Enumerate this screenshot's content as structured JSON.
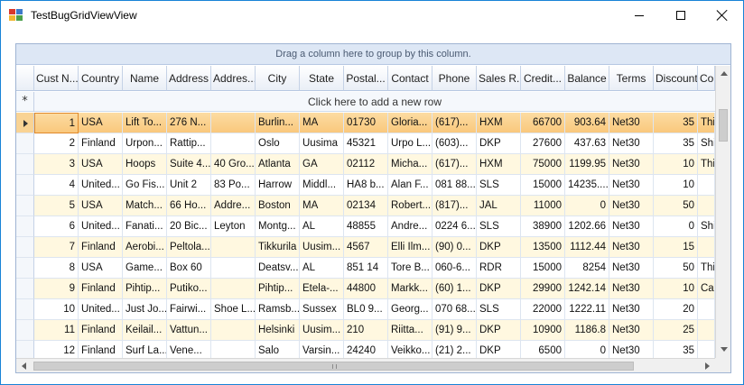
{
  "window": {
    "title": "TestBugGridViewView",
    "icon": "app-window-icon"
  },
  "grid": {
    "group_panel_text": "Drag a column here to group by this column.",
    "new_row_text": "Click here to add a new row",
    "new_row_symbol": "*",
    "columns": [
      "Cust N...",
      "Country",
      "Name",
      "Address",
      "Addres...",
      "City",
      "State",
      "Postal...",
      "Contact",
      "Phone",
      "Sales R...",
      "Credit...",
      "Balance",
      "Terms",
      "Discount",
      "Co"
    ],
    "rows": [
      [
        "1",
        "USA",
        "Lift To...",
        "276 N...",
        "",
        "Burlin...",
        "MA",
        "01730",
        "Gloria...",
        "(617)...",
        "HXM",
        "66700",
        "903.64",
        "Net30",
        "35",
        "Thi"
      ],
      [
        "2",
        "Finland",
        "Urpon...",
        "Rattip...",
        "",
        "Oslo",
        "Uusima",
        "45321",
        "Urpo L...",
        "(603)...",
        "DKP",
        "27600",
        "437.63",
        "Net30",
        "35",
        "Shi"
      ],
      [
        "3",
        "USA",
        "Hoops",
        "Suite 4...",
        "40 Gro...",
        "Atlanta",
        "GA",
        "02112",
        "Micha...",
        "(617)...",
        "HXM",
        "75000",
        "1199.95",
        "Net30",
        "10",
        "Thi"
      ],
      [
        "4",
        "United...",
        "Go Fis...",
        "Unit 2",
        "83 Po...",
        "Harrow",
        "Middl...",
        "HA8 b...",
        "Alan F...",
        "081 88...",
        "SLS",
        "15000",
        "14235....",
        "Net30",
        "10",
        ""
      ],
      [
        "5",
        "USA",
        "Match...",
        "66 Ho...",
        "Addre...",
        "Boston",
        "MA",
        "02134",
        "Robert...",
        "(817)...",
        "JAL",
        "11000",
        "0",
        "Net30",
        "50",
        ""
      ],
      [
        "6",
        "United...",
        "Fanati...",
        "20 Bic...",
        "Leyton",
        "Montg...",
        "AL",
        "48855",
        "Andre...",
        "0224 6...",
        "SLS",
        "38900",
        "1202.66",
        "Net30",
        "0",
        "Shi"
      ],
      [
        "7",
        "Finland",
        "Aerobi...",
        "Peltola...",
        "",
        "Tikkurila",
        "Uusim...",
        "4567",
        "Elli Ilm...",
        "(90) 0...",
        "DKP",
        "13500",
        "1112.44",
        "Net30",
        "15",
        ""
      ],
      [
        "8",
        "USA",
        "Game...",
        "Box 60",
        "",
        "Deatsv...",
        "AL",
        "851 14",
        "Tore B...",
        "060-6...",
        "RDR",
        "15000",
        "8254",
        "Net30",
        "50",
        "Thi"
      ],
      [
        "9",
        "Finland",
        "Pihtip...",
        "Putiko...",
        "",
        "Pihtip...",
        "Etela-...",
        "44800",
        "Markk...",
        "(60) 1...",
        "DKP",
        "29900",
        "1242.14",
        "Net30",
        "10",
        "Cal"
      ],
      [
        "10",
        "United...",
        "Just Jo...",
        "Fairwi...",
        "Shoe L...",
        "Ramsb...",
        "Sussex",
        "BL0 9...",
        "Georg...",
        "070 68...",
        "SLS",
        "22000",
        "1222.11",
        "Net30",
        "20",
        ""
      ],
      [
        "11",
        "Finland",
        "Keilail...",
        "Vattun...",
        "",
        "Helsinki",
        "Uusim...",
        "210",
        "Riitta...",
        "(91) 9...",
        "DKP",
        "10900",
        "1186.8",
        "Net30",
        "25",
        ""
      ],
      [
        "12",
        "Finland",
        "Surf La...",
        "Vene...",
        "",
        "Salo",
        "Varsin...",
        "24240",
        "Veikko...",
        "(21) 2...",
        "DKP",
        "6500",
        "0",
        "Net30",
        "35",
        ""
      ]
    ],
    "selected_row": 0,
    "colors": {
      "selected_row": "#f9c77b",
      "alternate_row": "#fff8e0",
      "header": "#e9eef6",
      "group_panel": "#dde7f5",
      "window_border": "#1883d7"
    }
  }
}
